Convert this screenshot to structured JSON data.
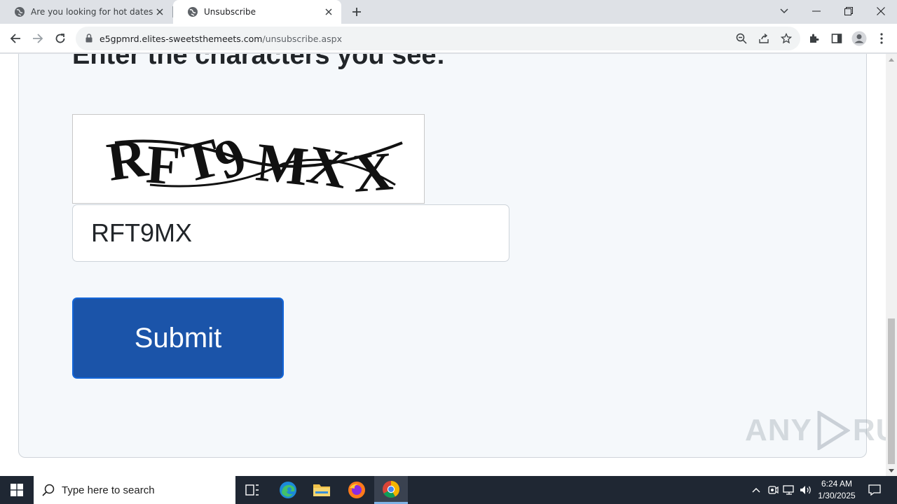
{
  "browser": {
    "tabs": [
      {
        "title": "Are you looking for hot dates in",
        "active": false
      },
      {
        "title": "Unsubscribe",
        "active": true
      }
    ],
    "url_domain": "e5gpmrd.elites-sweetsthemeets.com",
    "url_path": "/unsubscribe.aspx"
  },
  "page": {
    "heading": "Enter the characters you see:",
    "captcha_image_text": "RFT9MX",
    "captcha_input_value": "RFT9MX",
    "submit_label": "Submit",
    "watermark": {
      "left": "ANY",
      "right": "RUN"
    }
  },
  "taskbar": {
    "search_placeholder": "Type here to search",
    "time": "6:24 AM",
    "date": "1/30/2025"
  },
  "colors": {
    "submit_bg": "#1b54a9",
    "card_bg": "#f5f8fb",
    "taskbar_bg": "#1f2733"
  }
}
